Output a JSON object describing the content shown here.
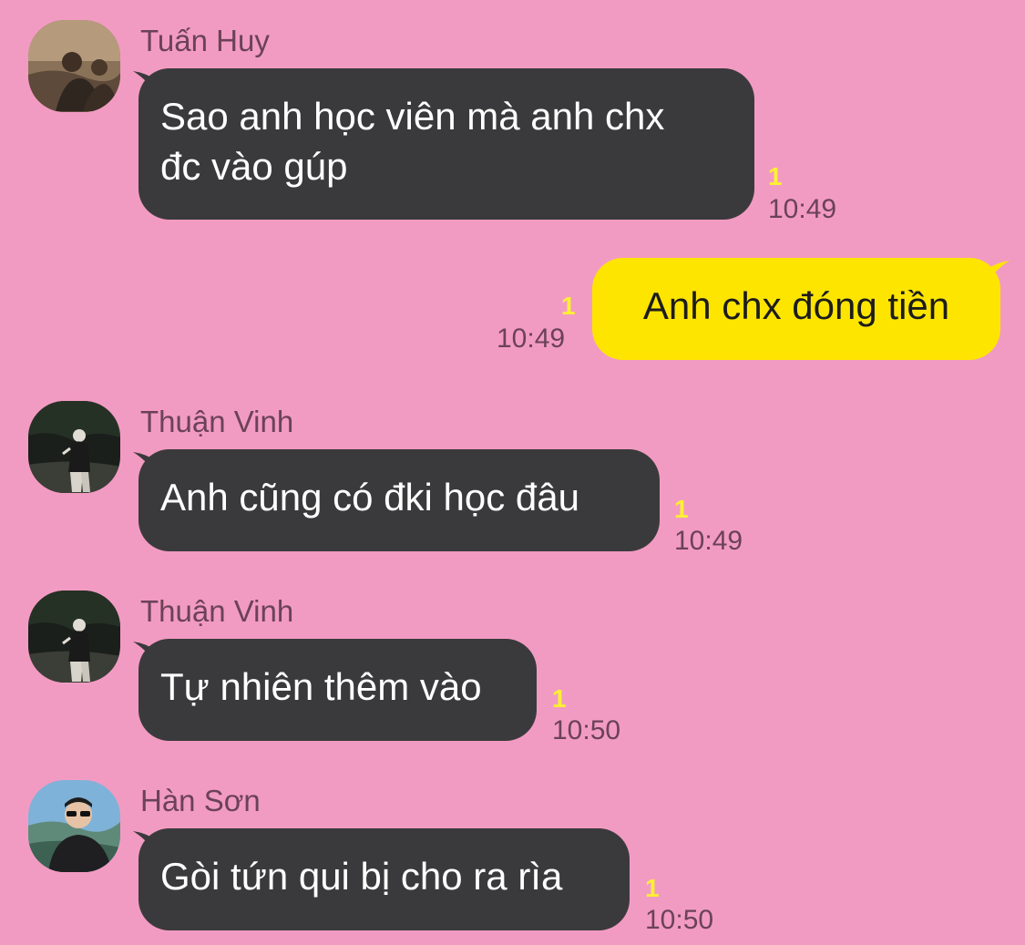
{
  "colors": {
    "background": "#f29bc2",
    "incoming_bubble": "#3a3a3c",
    "outgoing_bubble": "#fee500",
    "meta_text": "#6b4257",
    "unread_count": "#fef032"
  },
  "messages": [
    {
      "sender": "Tuấn Huy",
      "avatar": "avatar-icon",
      "lines": [
        "Sao anh học viên mà anh chx",
        "đc vào gúp"
      ],
      "unread": "1",
      "time": "10:49"
    },
    {
      "sender": "",
      "outgoing": true,
      "lines": [
        "Anh chx đóng tiền"
      ],
      "unread": "1",
      "time": "10:49"
    },
    {
      "sender": "Thuận Vinh",
      "avatar": "avatar-icon",
      "lines": [
        "Anh cũng có đki học đâu"
      ],
      "unread": "1",
      "time": "10:49"
    },
    {
      "sender": "Thuận Vinh",
      "avatar": "avatar-icon",
      "lines": [
        "Tự nhiên thêm vào"
      ],
      "unread": "1",
      "time": "10:50"
    },
    {
      "sender": "Hàn Sơn",
      "avatar": "avatar-icon",
      "lines": [
        "Gòi tứn qui bị cho ra rìa"
      ],
      "unread": "1",
      "time": "10:50"
    }
  ]
}
